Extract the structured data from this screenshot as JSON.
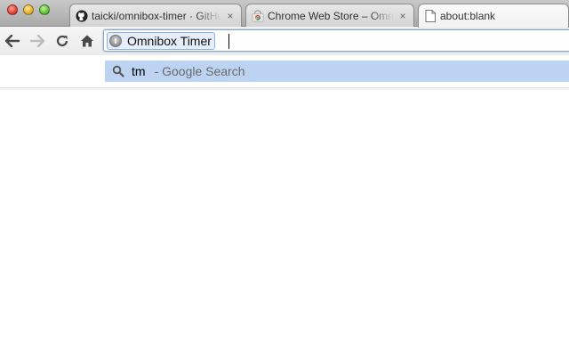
{
  "window": {
    "controls": [
      "close",
      "minimize",
      "zoom"
    ]
  },
  "tabs": [
    {
      "title": "taicki/omnibox-timer · GitHub",
      "icon": "github-icon",
      "close": "×"
    },
    {
      "title": "Chrome Web Store – Omnibox Timer",
      "icon": "chrome-web-store-icon",
      "close": "×"
    },
    {
      "title": "about:blank",
      "icon": "blank-page-icon",
      "close": ""
    }
  ],
  "toolbar": {
    "back": "back-arrow-icon",
    "forward": "forward-arrow-icon",
    "reload": "reload-icon",
    "home": "home-icon"
  },
  "omnibox": {
    "keyword_chip": "Omnibox Timer",
    "value": ""
  },
  "suggestion": {
    "query": "tm",
    "provider": "- Google Search"
  },
  "colors": {
    "selection": "#bcd3f2",
    "chip_bg": "#e6eef9"
  }
}
